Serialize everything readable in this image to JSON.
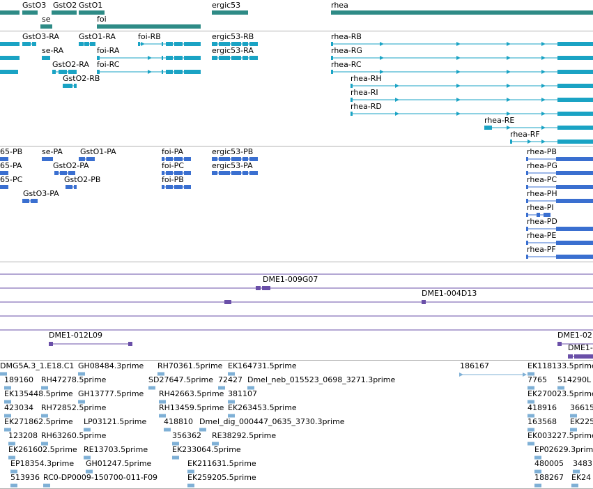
{
  "colors": {
    "gene": "#2e8b86",
    "transcript": "#1aa3c4",
    "cds": "#3a6fd0",
    "clone": "#6a4fa8",
    "est": "#7fb0d6",
    "separator": "#b0b0b0"
  },
  "genes": {
    "items": [
      {
        "id": "g-left",
        "label": ""
      },
      {
        "id": "GstO3",
        "label": "GstO3"
      },
      {
        "id": "se",
        "label": "se"
      },
      {
        "id": "GstO2",
        "label": "GstO2"
      },
      {
        "id": "GstO1",
        "label": "GstO1"
      },
      {
        "id": "foi",
        "label": "foi"
      },
      {
        "id": "ergic53",
        "label": "ergic53"
      },
      {
        "id": "rhea",
        "label": "rhea"
      }
    ]
  },
  "transcripts": {
    "items": [
      {
        "id": "t-left1",
        "label": ""
      },
      {
        "id": "t-left2",
        "label": ""
      },
      {
        "id": "t-left3",
        "label": ""
      },
      {
        "id": "GstO3-RA",
        "label": "GstO3-RA"
      },
      {
        "id": "se-RA",
        "label": "se-RA"
      },
      {
        "id": "GstO2-RA",
        "label": "GstO2-RA"
      },
      {
        "id": "GstO2-RB",
        "label": "GstO2-RB"
      },
      {
        "id": "GstO1-RA",
        "label": "GstO1-RA"
      },
      {
        "id": "foi-RB",
        "label": "foi-RB"
      },
      {
        "id": "foi-RA",
        "label": "foi-RA"
      },
      {
        "id": "foi-RC",
        "label": "foi-RC"
      },
      {
        "id": "ergic53-RB",
        "label": "ergic53-RB"
      },
      {
        "id": "ergic53-RA",
        "label": "ergic53-RA"
      },
      {
        "id": "rhea-RB",
        "label": "rhea-RB"
      },
      {
        "id": "rhea-RG",
        "label": "rhea-RG"
      },
      {
        "id": "rhea-RC",
        "label": "rhea-RC"
      },
      {
        "id": "rhea-RH",
        "label": "rhea-RH"
      },
      {
        "id": "rhea-RI",
        "label": "rhea-RI"
      },
      {
        "id": "rhea-RD",
        "label": "rhea-RD"
      },
      {
        "id": "rhea-RE",
        "label": "rhea-RE"
      },
      {
        "id": "rhea-RF",
        "label": "rhea-RF"
      }
    ]
  },
  "cds": {
    "items": [
      {
        "id": "65-PB",
        "label": "65-PB"
      },
      {
        "id": "65-PA",
        "label": "65-PA"
      },
      {
        "id": "65-PC",
        "label": "65-PC"
      },
      {
        "id": "se-PA",
        "label": "se-PA"
      },
      {
        "id": "GstO2-PA",
        "label": "GstO2-PA"
      },
      {
        "id": "GstO2-PB",
        "label": "GstO2-PB"
      },
      {
        "id": "GstO3-PA",
        "label": "GstO3-PA"
      },
      {
        "id": "GstO1-PA",
        "label": "GstO1-PA"
      },
      {
        "id": "foi-PA",
        "label": "foi-PA"
      },
      {
        "id": "foi-PC",
        "label": "foi-PC"
      },
      {
        "id": "foi-PB",
        "label": "foi-PB"
      },
      {
        "id": "ergic53-PB",
        "label": "ergic53-PB"
      },
      {
        "id": "ergic53-PA",
        "label": "ergic53-PA"
      },
      {
        "id": "rhea-PB",
        "label": "rhea-PB"
      },
      {
        "id": "rhea-PG",
        "label": "rhea-PG"
      },
      {
        "id": "rhea-PC",
        "label": "rhea-PC"
      },
      {
        "id": "rhea-PH",
        "label": "rhea-PH"
      },
      {
        "id": "rhea-PI",
        "label": "rhea-PI"
      },
      {
        "id": "rhea-PD",
        "label": "rhea-PD"
      },
      {
        "id": "rhea-PE",
        "label": "rhea-PE"
      },
      {
        "id": "rhea-PF",
        "label": "rhea-PF"
      }
    ]
  },
  "clones": {
    "items": [
      {
        "id": "DME1-009G07",
        "label": "DME1-009G07"
      },
      {
        "id": "DME1-004D13",
        "label": "DME1-004D13"
      },
      {
        "id": "DME1-012L09",
        "label": "DME1-012L09"
      },
      {
        "id": "DME1-02",
        "label": "DME1-02"
      },
      {
        "id": "DME1-x",
        "label": "DME1-"
      }
    ]
  },
  "ests": {
    "items": [
      {
        "label": "DMG5A.3_1.E18.C1"
      },
      {
        "label": "GH08484.3prime"
      },
      {
        "label": "RH70361.5prime"
      },
      {
        "label": "EK164731.5prime"
      },
      {
        "label": "186167"
      },
      {
        "label": "EK118133.5prime"
      },
      {
        "label": "189160"
      },
      {
        "label": "RH47278.5prime"
      },
      {
        "label": "SD27647.5prime"
      },
      {
        "label": "72427"
      },
      {
        "label": "Dmel_neb_015523_0698_3271.3prime"
      },
      {
        "label": "7765"
      },
      {
        "label": "514290L"
      },
      {
        "label": "EK135448.5prime"
      },
      {
        "label": "GH13777.5prime"
      },
      {
        "label": "RH42663.5prime"
      },
      {
        "label": "381107"
      },
      {
        "label": "EK270023.5prime"
      },
      {
        "label": "423034"
      },
      {
        "label": "RH72852.5prime"
      },
      {
        "label": "RH13459.5prime"
      },
      {
        "label": "EK263453.5prime"
      },
      {
        "label": "418916"
      },
      {
        "label": "36615"
      },
      {
        "label": "EK271862.5prime"
      },
      {
        "label": "LP03121.5prime"
      },
      {
        "label": "418810"
      },
      {
        "label": "Dmel_dig_000447_0635_3730.3prime"
      },
      {
        "label": "163568"
      },
      {
        "label": "EK225"
      },
      {
        "label": "123208"
      },
      {
        "label": "RH63260.5prime"
      },
      {
        "label": "356362"
      },
      {
        "label": "RE38292.5prime"
      },
      {
        "label": "EK003227.5prime"
      },
      {
        "label": "EK261602.5prime"
      },
      {
        "label": "RE13703.5prime"
      },
      {
        "label": "EK233064.5prime"
      },
      {
        "label": "EP02629.3prime"
      },
      {
        "label": "EP18354.3prime"
      },
      {
        "label": "GH01247.5prime"
      },
      {
        "label": "EK211631.5prime"
      },
      {
        "label": "480005"
      },
      {
        "label": "3483"
      },
      {
        "label": "513936"
      },
      {
        "label": "RC0-DP0009-150700-011-F09"
      },
      {
        "label": "EK259205.5prime"
      },
      {
        "label": "188267"
      },
      {
        "label": "EK24"
      }
    ]
  }
}
